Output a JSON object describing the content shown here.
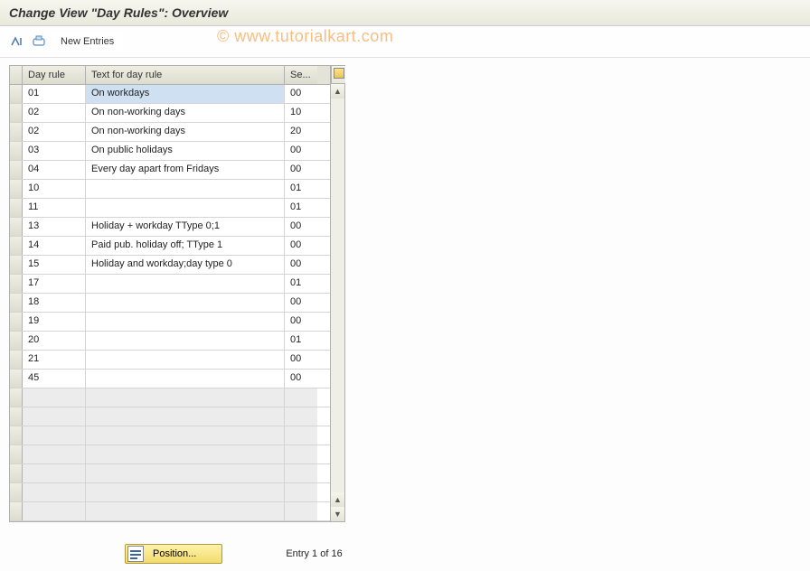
{
  "title": "Change View \"Day Rules\": Overview",
  "watermark": "© www.tutorialkart.com",
  "toolbar": {
    "new_entries_label": "New Entries"
  },
  "table": {
    "headers": {
      "day_rule": "Day rule",
      "text": "Text for day rule",
      "se": "Se..."
    },
    "rows": [
      {
        "day_rule": "01",
        "text": "On workdays",
        "se": "00",
        "highlighted": true
      },
      {
        "day_rule": "02",
        "text": "On non-working days",
        "se": "10"
      },
      {
        "day_rule": "02",
        "text": "On non-working days",
        "se": "20"
      },
      {
        "day_rule": "03",
        "text": "On public holidays",
        "se": "00"
      },
      {
        "day_rule": "04",
        "text": "Every day apart from Fridays",
        "se": "00"
      },
      {
        "day_rule": "10",
        "text": "",
        "se": "01"
      },
      {
        "day_rule": "11",
        "text": "",
        "se": "01"
      },
      {
        "day_rule": "13",
        "text": "Holiday + workday TType 0;1",
        "se": "00"
      },
      {
        "day_rule": "14",
        "text": "Paid pub. holiday off; TType 1",
        "se": "00"
      },
      {
        "day_rule": "15",
        "text": "Holiday and workday;day type 0",
        "se": "00"
      },
      {
        "day_rule": "17",
        "text": "",
        "se": "01"
      },
      {
        "day_rule": "18",
        "text": "",
        "se": "00"
      },
      {
        "day_rule": "19",
        "text": "",
        "se": "00"
      },
      {
        "day_rule": "20",
        "text": "",
        "se": "01"
      },
      {
        "day_rule": "21",
        "text": "",
        "se": "00"
      },
      {
        "day_rule": "45",
        "text": "",
        "se": "00"
      }
    ],
    "empty_rows": 7
  },
  "footer": {
    "position_label": "Position...",
    "entry_text": "Entry 1 of 16"
  }
}
